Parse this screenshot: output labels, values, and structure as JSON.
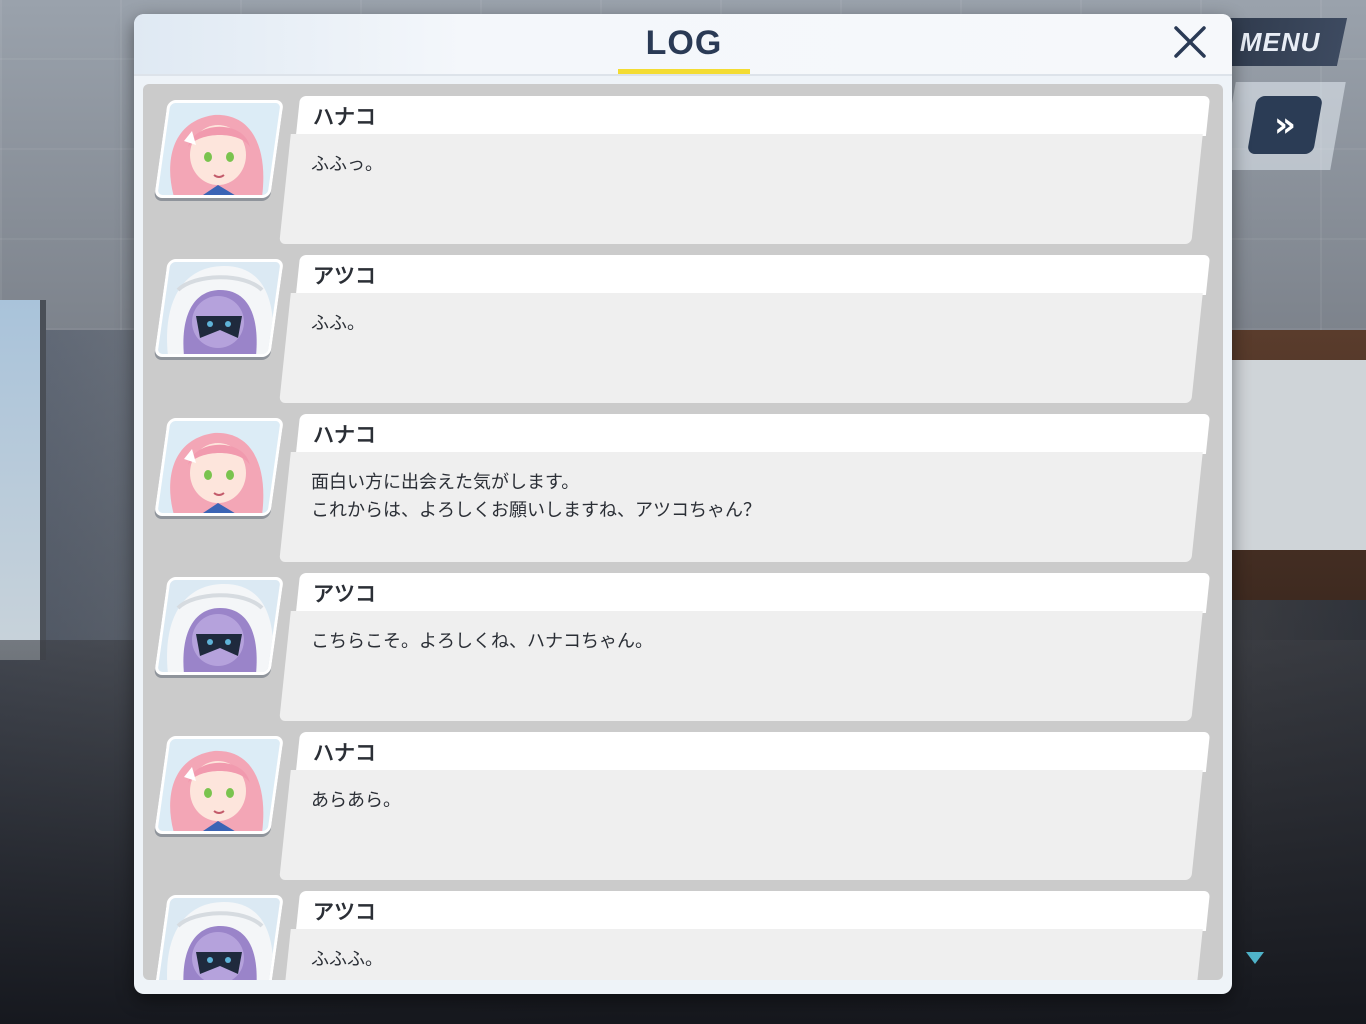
{
  "header": {
    "title": "LOG",
    "close_icon": "close-icon",
    "accent_color": "#f3dc33"
  },
  "overlay": {
    "menu_label": "MENU",
    "fast_forward_icon": "fast-forward-icon",
    "scroll_down_icon": "triangle-down-icon"
  },
  "entries": [
    {
      "speaker": "ハナコ",
      "portrait": "hanako",
      "lines": [
        "ふふっ。"
      ]
    },
    {
      "speaker": "アツコ",
      "portrait": "atsuko",
      "lines": [
        "ふふ。"
      ]
    },
    {
      "speaker": "ハナコ",
      "portrait": "hanako",
      "lines": [
        "面白い方に出会えた気がします。",
        "これからは、よろしくお願いしますね、アツコちゃん？"
      ]
    },
    {
      "speaker": "アツコ",
      "portrait": "atsuko",
      "lines": [
        "こちらこそ。よろしくね、ハナコちゃん。"
      ]
    },
    {
      "speaker": "ハナコ",
      "portrait": "hanako",
      "lines": [
        "あらあら。"
      ]
    },
    {
      "speaker": "アツコ",
      "portrait": "atsuko",
      "lines": [
        "ふふふ。"
      ]
    }
  ]
}
